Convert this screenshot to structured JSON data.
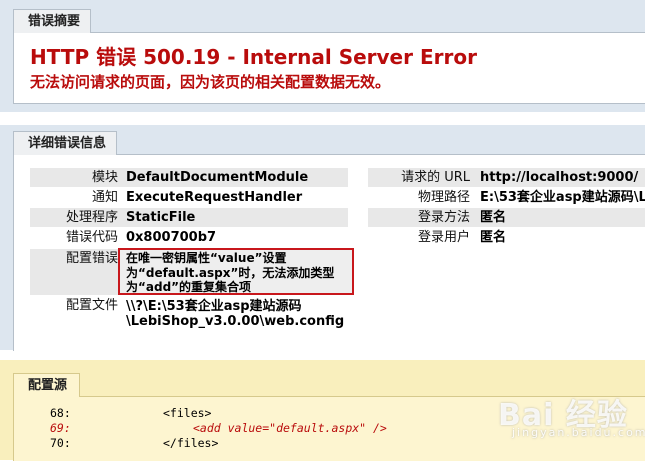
{
  "summary": {
    "tab": "错误摘要",
    "title": "HTTP 错误 500.19 - Internal Server Error",
    "subtitle": "无法访问请求的页面，因为该页的相关配置数据无效。"
  },
  "details": {
    "tab": "详细错误信息",
    "left": [
      {
        "label": "模块",
        "value": "DefaultDocumentModule"
      },
      {
        "label": "通知",
        "value": "ExecuteRequestHandler"
      },
      {
        "label": "处理程序",
        "value": "StaticFile"
      },
      {
        "label": "错误代码",
        "value": "0x800700b7"
      },
      {
        "label": "配置错误",
        "value": "在唯一密钥属性“value”设置为“default.aspx”时，无法添加类型为“add”的重复集合项"
      },
      {
        "label": "配置文件",
        "value": "\\\\?\\E:\\53套企业asp建站源码\\LebiShop_v3.0.00\\web.config"
      }
    ],
    "config_error_lines": [
      "在唯一密钥属性“value”设置",
      "为“default.aspx”时，无法添加类型",
      "为“add”的重复集合项"
    ],
    "config_file_lines": [
      "\\\\?\\E:\\53套企业asp建站源码",
      "\\LebiShop_v3.0.00\\web.config"
    ],
    "right": [
      {
        "label": "请求的 URL",
        "value": "http://localhost:9000/"
      },
      {
        "label": "物理路径",
        "value": "E:\\53套企业asp建站源码\\L"
      },
      {
        "label": "登录方法",
        "value": "匿名"
      },
      {
        "label": "登录用户",
        "value": "匿名"
      }
    ]
  },
  "source": {
    "tab": "配置源",
    "lines": [
      {
        "num": "68:",
        "code": "<files>"
      },
      {
        "num": "69:",
        "code": "<add value=\"default.aspx\" />"
      },
      {
        "num": "70:",
        "code": "</files>"
      }
    ]
  },
  "watermark": {
    "text": "Bai 经验",
    "sub": "jingyan.baidu.com"
  },
  "colors": {
    "error_red": "#b90c0c",
    "band_blue": "#dde6ef",
    "highlight_border": "#c8171c",
    "source_yellow": "#f9efbd"
  }
}
